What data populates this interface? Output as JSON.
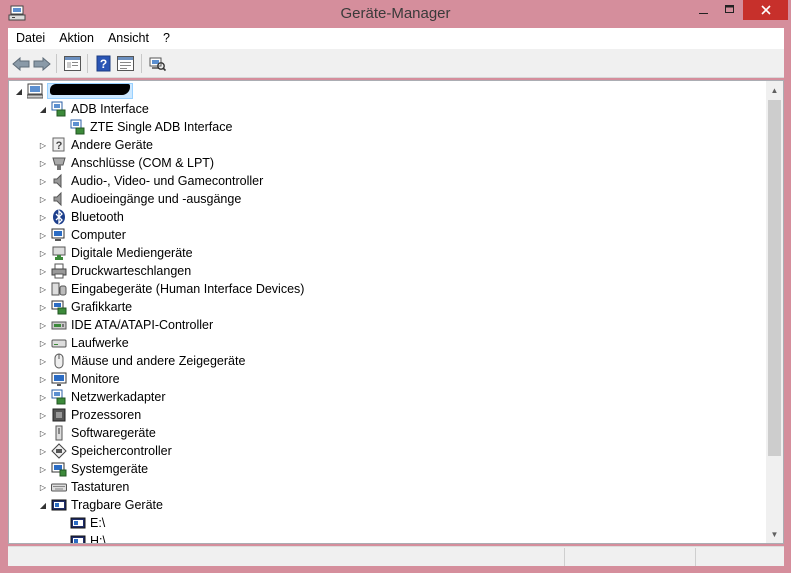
{
  "window": {
    "title": "Geräte-Manager",
    "title_color": "#d58e9c",
    "close_color": "#c7302b"
  },
  "menubar": {
    "items": [
      {
        "label": "Datei"
      },
      {
        "label": "Aktion"
      },
      {
        "label": "Ansicht"
      },
      {
        "label": "?"
      }
    ]
  },
  "toolbar": {
    "buttons": [
      "back-arrow-icon",
      "forward-arrow-icon",
      "properties-view-icon",
      "help-icon",
      "console-view-icon",
      "scan-hardware-icon"
    ]
  },
  "tree": {
    "root": {
      "label": "",
      "redacted": true,
      "icon": "computer-icon",
      "expanded": true
    },
    "items": [
      {
        "label": "ADB Interface",
        "level": 1,
        "expanded": true,
        "icon": "adb-interface-icon"
      },
      {
        "label": "ZTE Single ADB Interface",
        "level": 2,
        "icon": "adb-device-icon"
      },
      {
        "label": "Andere Geräte",
        "level": 1,
        "icon": "unknown-device-icon"
      },
      {
        "label": "Anschlüsse (COM & LPT)",
        "level": 1,
        "icon": "port-icon"
      },
      {
        "label": "Audio-, Video- und Gamecontroller",
        "level": 1,
        "icon": "speaker-icon"
      },
      {
        "label": "Audioeingänge und -ausgänge",
        "level": 1,
        "icon": "speaker-icon"
      },
      {
        "label": "Bluetooth",
        "level": 1,
        "icon": "bluetooth-icon"
      },
      {
        "label": "Computer",
        "level": 1,
        "icon": "computer-icon"
      },
      {
        "label": "Digitale Mediengeräte",
        "level": 1,
        "icon": "media-device-icon"
      },
      {
        "label": "Druckwarteschlangen",
        "level": 1,
        "icon": "printer-icon"
      },
      {
        "label": "Eingabegeräte (Human Interface Devices)",
        "level": 1,
        "icon": "hid-icon"
      },
      {
        "label": "Grafikkarte",
        "level": 1,
        "icon": "display-adapter-icon"
      },
      {
        "label": "IDE ATA/ATAPI-Controller",
        "level": 1,
        "icon": "ide-controller-icon"
      },
      {
        "label": "Laufwerke",
        "level": 1,
        "icon": "disk-drive-icon"
      },
      {
        "label": "Mäuse und andere Zeigegeräte",
        "level": 1,
        "icon": "mouse-icon"
      },
      {
        "label": "Monitore",
        "level": 1,
        "icon": "monitor-icon"
      },
      {
        "label": "Netzwerkadapter",
        "level": 1,
        "icon": "network-adapter-icon"
      },
      {
        "label": "Prozessoren",
        "level": 1,
        "icon": "processor-icon"
      },
      {
        "label": "Softwaregeräte",
        "level": 1,
        "icon": "software-device-icon"
      },
      {
        "label": "Speichercontroller",
        "level": 1,
        "icon": "storage-controller-icon"
      },
      {
        "label": "Systemgeräte",
        "level": 1,
        "icon": "system-device-icon"
      },
      {
        "label": "Tastaturen",
        "level": 1,
        "icon": "keyboard-icon"
      },
      {
        "label": "Tragbare Geräte",
        "level": 1,
        "expanded": true,
        "icon": "portable-device-icon"
      },
      {
        "label": "E:\\",
        "level": 2,
        "icon": "portable-drive-icon"
      },
      {
        "label": "H:\\",
        "level": 2,
        "icon": "portable-drive-icon"
      }
    ]
  }
}
